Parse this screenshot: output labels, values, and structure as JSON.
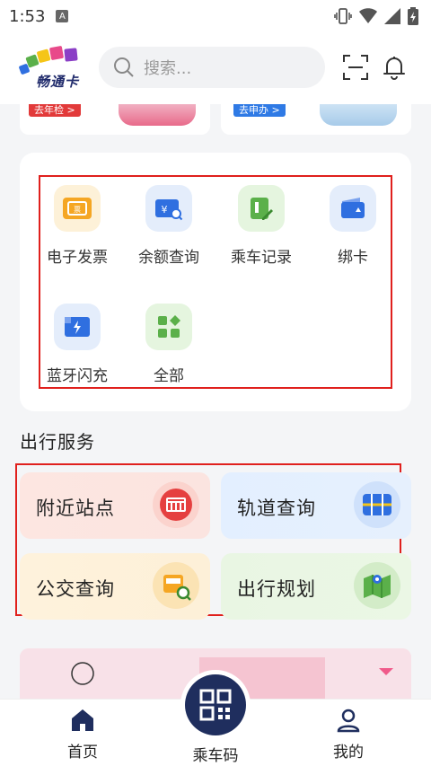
{
  "status": {
    "time": "1:53",
    "notification_letter": "A"
  },
  "header": {
    "logo_text": "畅通卡",
    "search_placeholder": "搜索..."
  },
  "top_cards": [
    {
      "tag": "去年检 >"
    },
    {
      "tag": "去申办 >"
    }
  ],
  "services": [
    {
      "label": "电子发票",
      "icon": "invoice-icon"
    },
    {
      "label": "余额查询",
      "icon": "balance-query-icon"
    },
    {
      "label": "乘车记录",
      "icon": "ride-record-icon"
    },
    {
      "label": "绑卡",
      "icon": "bind-card-icon"
    },
    {
      "label": "蓝牙闪充",
      "icon": "bluetooth-charge-icon"
    },
    {
      "label": "全部",
      "icon": "all-grid-icon"
    }
  ],
  "travel_section": {
    "title": "出行服务",
    "cards": [
      {
        "label": "附近站点",
        "icon": "bus-stop-icon"
      },
      {
        "label": "轨道查询",
        "icon": "rail-icon"
      },
      {
        "label": "公交查询",
        "icon": "bus-search-icon"
      },
      {
        "label": "出行规划",
        "icon": "map-icon"
      }
    ]
  },
  "nav": {
    "home": "首页",
    "qr": "乘车码",
    "mine": "我的"
  },
  "colors": {
    "nav_accent": "#1f2e5e",
    "outline": "#e0201d",
    "orange": "#f5a623",
    "blue": "#2f6fe0",
    "green": "#5bb04a",
    "red": "#e54040"
  }
}
